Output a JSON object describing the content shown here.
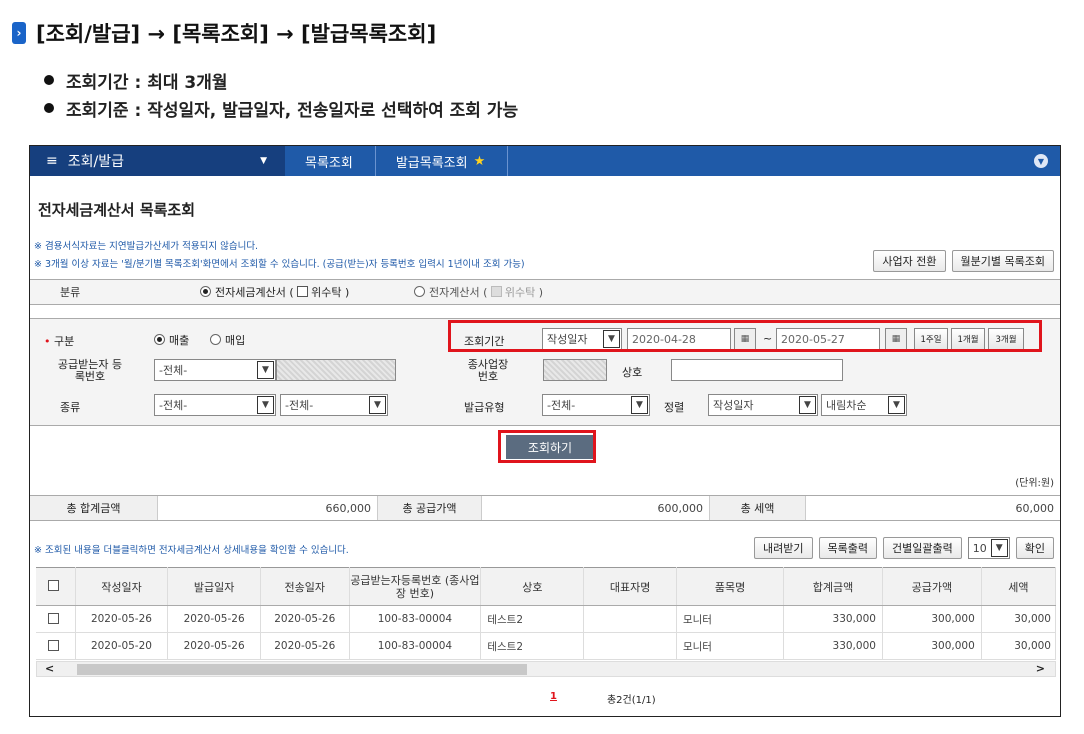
{
  "heading": {
    "path": "[조회/발급] → [목록조회] → [발급목록조회]"
  },
  "bullets": [
    "조회기간 : 최대 3개월",
    "조회기준 : 작성일자, 발급일자, 전송일자로 선택하여 조회 가능"
  ],
  "nav": {
    "menu": "조회/발급",
    "crumb1": "목록조회",
    "crumb2": "발급목록조회"
  },
  "page_title": "전자세금계산서 목록조회",
  "notes": [
    "※ 겸용서식자료는 지연발급가산세가 적용되지 않습니다.",
    "※ 3개월 이상 자료는 '월/분기별 목록조회'화면에서 조회할 수 있습니다. (공급(받는)자 등록번호 입력시 1년이내 조회 가능)"
  ],
  "top_buttons": {
    "switch": "사업자 전환",
    "monthly": "월분기별 목록조회"
  },
  "classification": {
    "label": "분류",
    "opt1": "전자세금계산서",
    "opt1b": "(",
    "opt1c": "위수탁",
    "opt1d": ")",
    "opt2": "전자계산서",
    "opt2b": "(",
    "opt2c": "위수탁",
    "opt2d": ")"
  },
  "search": {
    "type_label": "구분",
    "sales": "매출",
    "purchase": "매입",
    "period_label": "조회기간",
    "period_basis": "작성일자",
    "date_from": "2020-04-28",
    "tilde": "~",
    "date_to": "2020-05-27",
    "btn_1w": "1주일",
    "btn_1m": "1개월",
    "btn_3m": "3개월",
    "recipient_label": "공급받는자 등록번호",
    "recipient_value": "-전체-",
    "branch_label": "종사업장 번호",
    "company_label": "상호",
    "kind_label": "종류",
    "kind1": "-전체-",
    "kind2": "-전체-",
    "issue_type_label": "발급유형",
    "issue_type": "-전체-",
    "sort_label": "정렬",
    "sort_field": "작성일자",
    "sort_order": "내림차순",
    "submit": "조회하기"
  },
  "unit": "(단위:원)",
  "totals": {
    "sum_label": "총 합계금액",
    "sum": "660,000",
    "supply_label": "총 공급가액",
    "supply": "600,000",
    "tax_label": "총 세액",
    "tax": "60,000"
  },
  "info": "※ 조회된 내용을 더블클릭하면 전자세금계산서 상세내용을 확인할 수 있습니다.",
  "list_buttons": {
    "download": "내려받기",
    "print": "목록출력",
    "batch": "건별일괄출력",
    "page_size": "10",
    "confirm": "확인"
  },
  "table": {
    "headers": [
      "작성일자",
      "발급일자",
      "전송일자",
      "공급받는자등록번호 (종사업장 번호)",
      "상호",
      "대표자명",
      "품목명",
      "합계금액",
      "공급가액",
      "세액"
    ],
    "rows": [
      [
        "2020-05-26",
        "2020-05-26",
        "2020-05-26",
        "100-83-00004",
        "테스트2",
        "",
        "모니터",
        "330,000",
        "300,000",
        "30,000"
      ],
      [
        "2020-05-20",
        "2020-05-26",
        "2020-05-26",
        "100-83-00004",
        "테스트2",
        "",
        "모니터",
        "330,000",
        "300,000",
        "30,000"
      ]
    ]
  },
  "pager": {
    "page": "1",
    "summary": "총2건(1/1)"
  }
}
